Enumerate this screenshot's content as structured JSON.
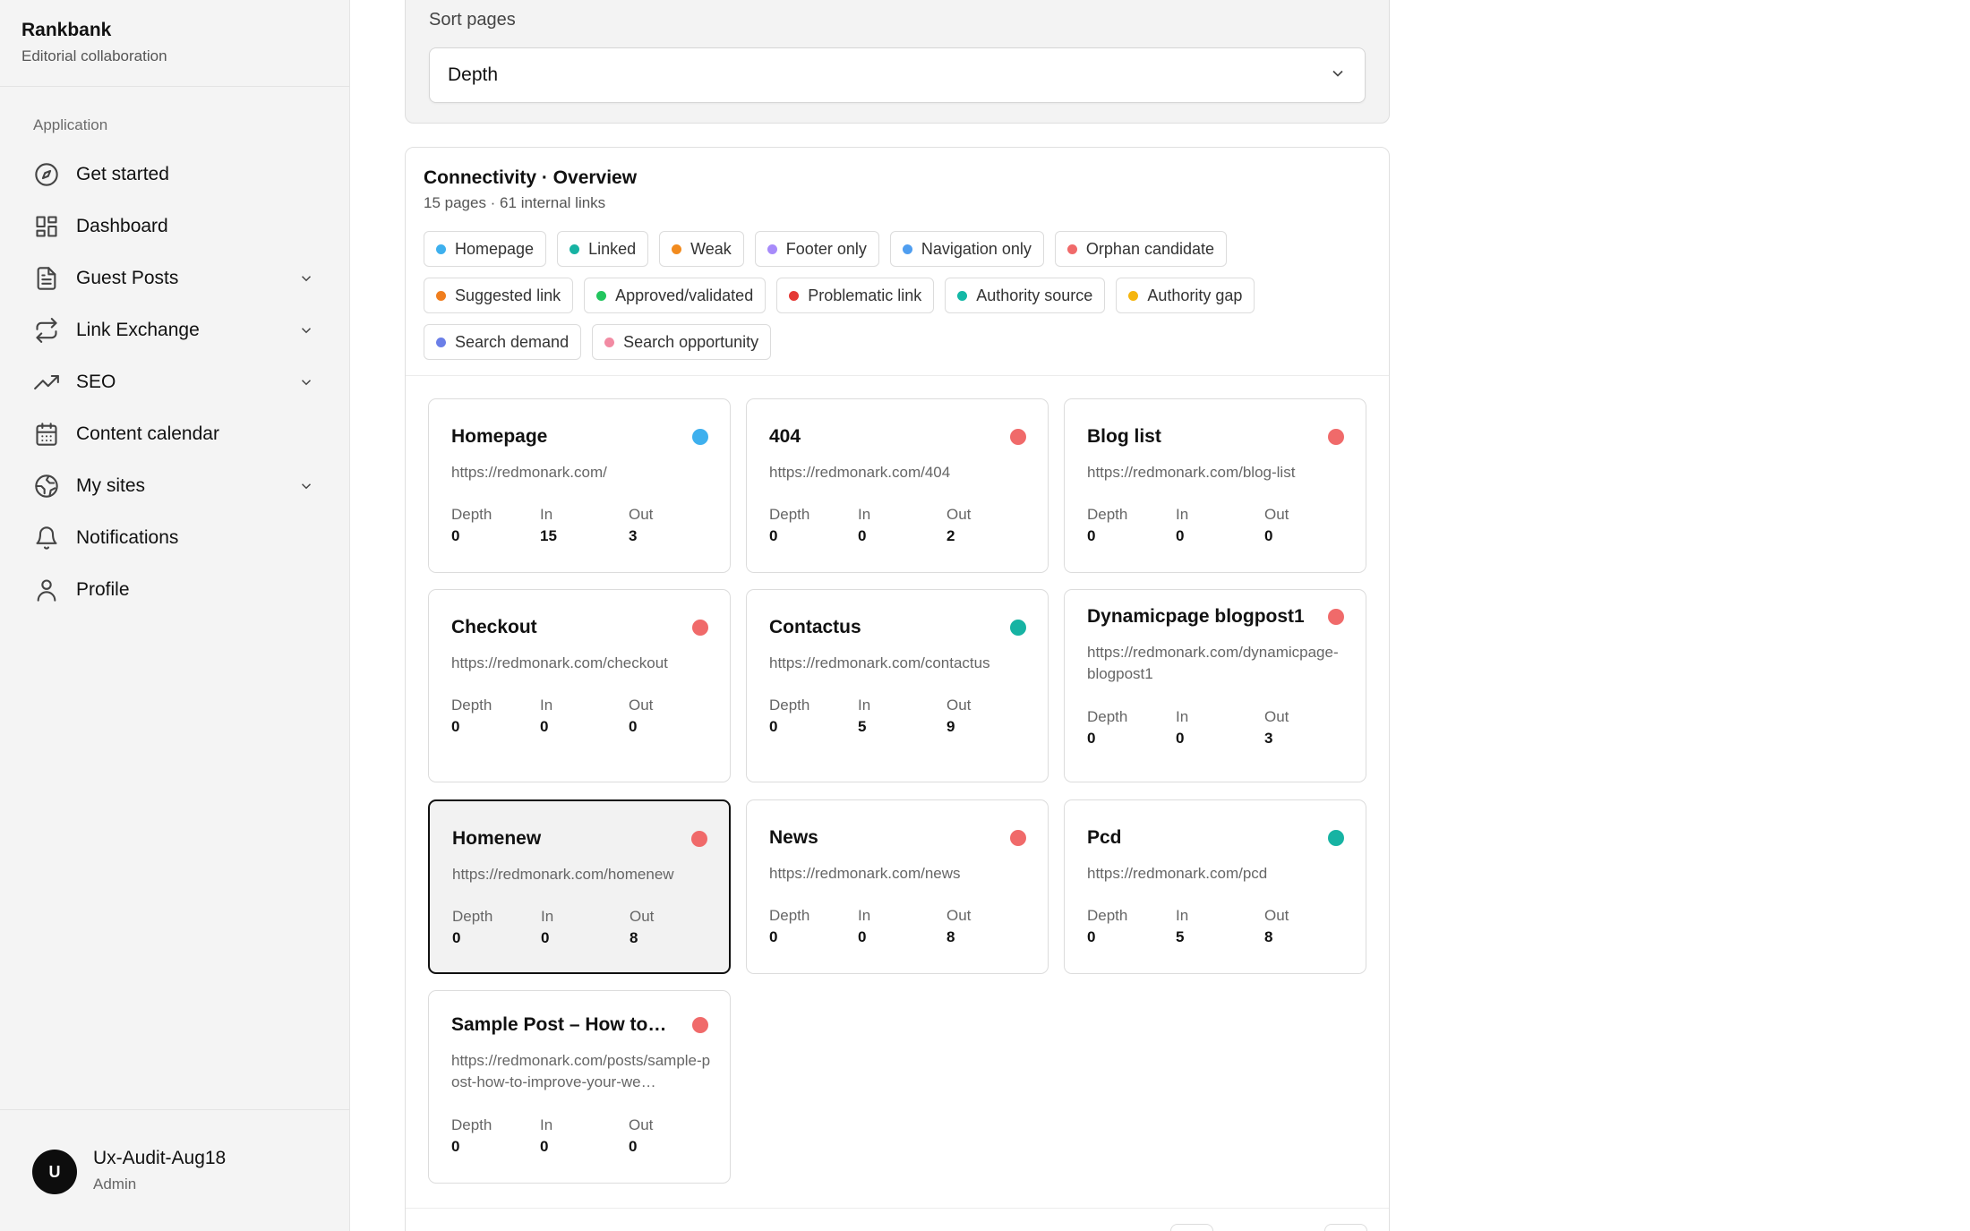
{
  "brand": {
    "name": "Rankbank",
    "subtitle": "Editorial collaboration"
  },
  "sidebar": {
    "group_label": "Application",
    "items": [
      {
        "label": "Get started",
        "icon": "compass-icon",
        "expandable": false
      },
      {
        "label": "Dashboard",
        "icon": "dashboard-grid-icon",
        "expandable": false
      },
      {
        "label": "Guest Posts",
        "icon": "document-icon",
        "expandable": true
      },
      {
        "label": "Link Exchange",
        "icon": "repeat-icon",
        "expandable": true
      },
      {
        "label": "SEO",
        "icon": "trending-up-icon",
        "expandable": true
      },
      {
        "label": "Content calendar",
        "icon": "calendar-icon",
        "expandable": false
      },
      {
        "label": "My sites",
        "icon": "globe-icon",
        "expandable": true
      },
      {
        "label": "Notifications",
        "icon": "bell-icon",
        "expandable": false
      },
      {
        "label": "Profile",
        "icon": "user-icon",
        "expandable": false
      }
    ]
  },
  "user": {
    "initial": "U",
    "name": "Ux-Audit-Aug18",
    "role": "Admin"
  },
  "sort": {
    "label": "Sort pages",
    "value": "Depth"
  },
  "overview": {
    "title": "Connectivity · Overview",
    "subtitle": "15 pages · 61 internal links",
    "legend": [
      {
        "label": "Homepage",
        "color": "#3eb0ee"
      },
      {
        "label": "Linked",
        "color": "#17b3a3"
      },
      {
        "label": "Weak",
        "color": "#f28b1e"
      },
      {
        "label": "Footer only",
        "color": "#a78bfa"
      },
      {
        "label": "Navigation only",
        "color": "#4f9ef0"
      },
      {
        "label": "Orphan candidate",
        "color": "#f06a6a"
      },
      {
        "label": "Suggested link",
        "color": "#f07e1e"
      },
      {
        "label": "Approved/validated",
        "color": "#22c55e"
      },
      {
        "label": "Problematic link",
        "color": "#e53935"
      },
      {
        "label": "Authority source",
        "color": "#14b8a6"
      },
      {
        "label": "Authority gap",
        "color": "#f5b50e"
      },
      {
        "label": "Search demand",
        "color": "#6b7fe8"
      },
      {
        "label": "Search opportunity",
        "color": "#f28ba3"
      }
    ],
    "stat_labels": {
      "depth": "Depth",
      "in": "In",
      "out": "Out"
    },
    "pages": [
      {
        "title": "Homepage",
        "url": "https://redmonark.com/",
        "depth": "0",
        "in": "15",
        "out": "3",
        "color": "#3eb0ee"
      },
      {
        "title": "404",
        "url": "https://redmonark.com/404",
        "depth": "0",
        "in": "0",
        "out": "2",
        "color": "#f06a6a"
      },
      {
        "title": "Blog list",
        "url": "https://redmonark.com/blog-list",
        "depth": "0",
        "in": "0",
        "out": "0",
        "color": "#f06a6a"
      },
      {
        "title": "Checkout",
        "url": "https://redmonark.com/checkout",
        "depth": "0",
        "in": "0",
        "out": "0",
        "color": "#f06a6a"
      },
      {
        "title": "Contactus",
        "url": "https://redmonark.com/contactus",
        "depth": "0",
        "in": "5",
        "out": "9",
        "color": "#17b3a3"
      },
      {
        "title": "Dynamicpage blogpost1",
        "url": "https://redmonark.com/dynamicpage-blogpost1",
        "depth": "0",
        "in": "0",
        "out": "3",
        "color": "#f06a6a"
      },
      {
        "title": "Homenew",
        "url": "https://redmonark.com/homenew",
        "depth": "0",
        "in": "0",
        "out": "8",
        "color": "#f06a6a"
      },
      {
        "title": "News",
        "url": "https://redmonark.com/news",
        "depth": "0",
        "in": "0",
        "out": "8",
        "color": "#f06a6a"
      },
      {
        "title": "Pcd",
        "url": "https://redmonark.com/pcd",
        "depth": "0",
        "in": "5",
        "out": "8",
        "color": "#17b3a3"
      },
      {
        "title": "Sample Post – How to…",
        "url": "https://redmonark.com/posts/sample-post-how-to-improve-your-we…",
        "depth": "0",
        "in": "0",
        "out": "0",
        "color": "#f06a6a"
      }
    ]
  }
}
